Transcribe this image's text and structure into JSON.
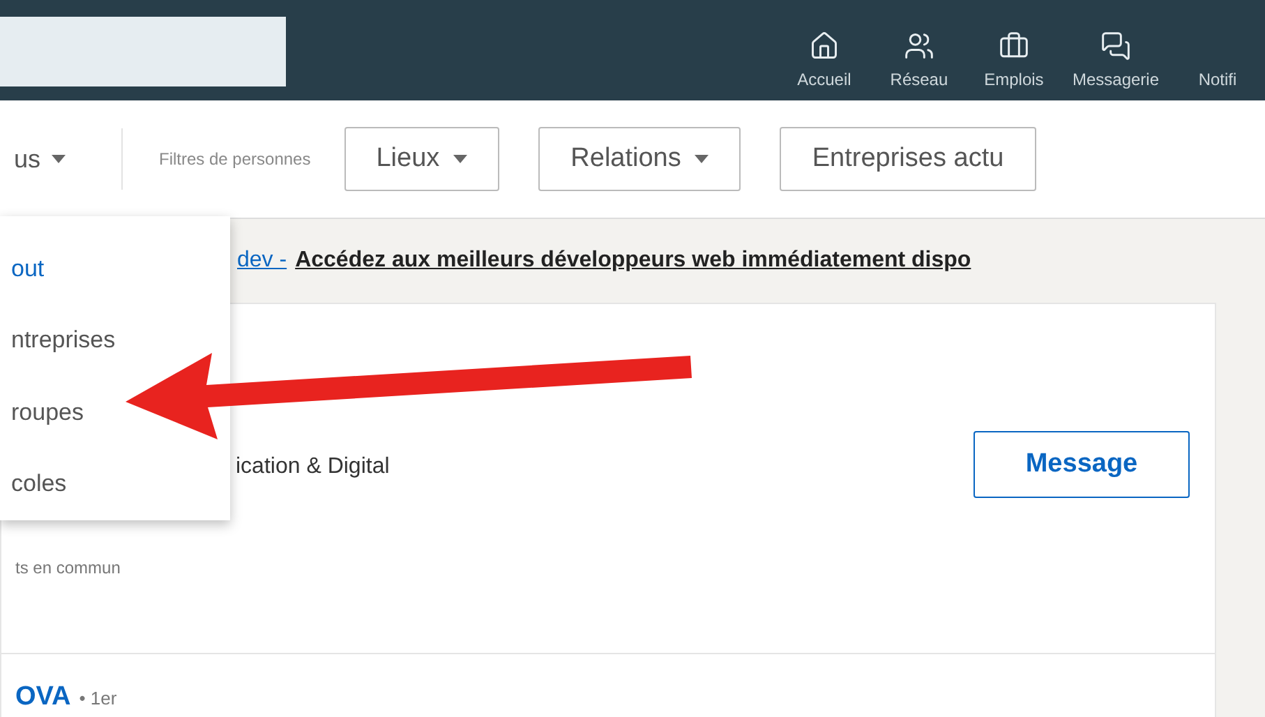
{
  "nav": {
    "items": [
      {
        "label": "Accueil"
      },
      {
        "label": "Réseau"
      },
      {
        "label": "Emplois"
      },
      {
        "label": "Messagerie"
      },
      {
        "label": "Notifi"
      }
    ]
  },
  "filters": {
    "type_dropdown": "us",
    "people_label": "Filtres de personnes",
    "buttons": [
      "Lieux",
      "Relations",
      "Entreprises actu"
    ]
  },
  "type_menu": [
    {
      "label": "out",
      "selected": true
    },
    {
      "label": "ntreprises",
      "selected": false
    },
    {
      "label": "roupes",
      "selected": false
    },
    {
      "label": "coles",
      "selected": false
    }
  ],
  "ad": {
    "link": "dev -",
    "text": "Accédez aux meilleurs développeurs web immédiatement dispo"
  },
  "results": [
    {
      "headline": "ication & Digital",
      "shared": "ts en commun",
      "action": "Message"
    },
    {
      "name": "OVA",
      "degree": "• 1er"
    }
  ]
}
